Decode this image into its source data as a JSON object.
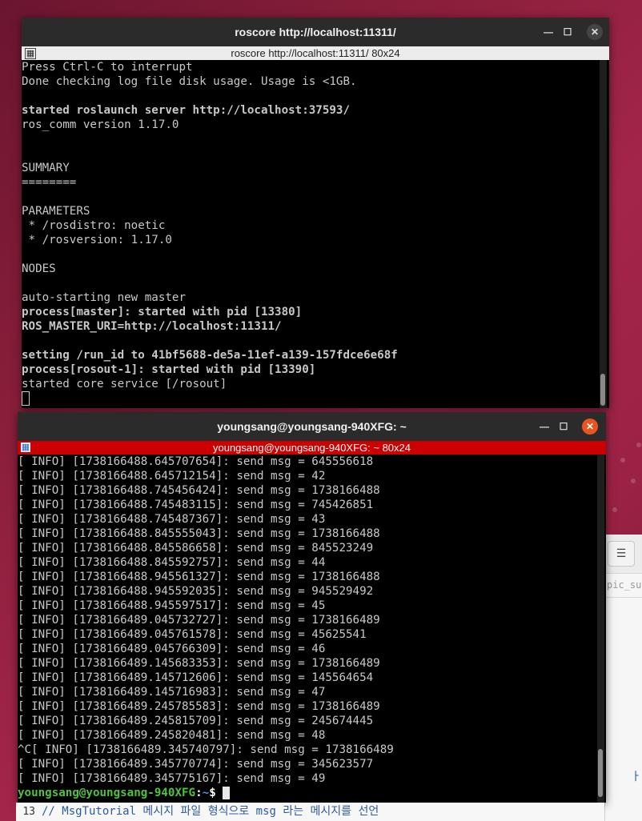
{
  "colors": {
    "terminal_bg": "#000000",
    "terminal_fg": "#c8c8c8",
    "prompt_green": "#4ec33b",
    "prompt_blue": "#5a8fe6",
    "close_orange": "#e95420",
    "tab_active_red": "#cc0000",
    "titlebar_dark": "#2b2b2b",
    "editor_comment_blue": "#2c5aa0"
  },
  "roscore_window": {
    "title": "roscore http://localhost:11311/",
    "tab_label": "roscore http://localhost:11311/ 80x24",
    "lines": [
      {
        "text": "Press Ctrl-C to interrupt",
        "bold": false
      },
      {
        "text": "Done checking log file disk usage. Usage is <1GB.",
        "bold": false
      },
      {
        "text": "",
        "bold": false
      },
      {
        "text": "started roslaunch server http://localhost:37593/",
        "bold": true
      },
      {
        "text": "ros_comm version 1.17.0",
        "bold": false
      },
      {
        "text": "",
        "bold": false
      },
      {
        "text": "",
        "bold": false
      },
      {
        "text": "SUMMARY",
        "bold": false
      },
      {
        "text": "========",
        "bold": false
      },
      {
        "text": "",
        "bold": false
      },
      {
        "text": "PARAMETERS",
        "bold": false
      },
      {
        "text": " * /rosdistro: noetic",
        "bold": false
      },
      {
        "text": " * /rosversion: 1.17.0",
        "bold": false
      },
      {
        "text": "",
        "bold": false
      },
      {
        "text": "NODES",
        "bold": false
      },
      {
        "text": "",
        "bold": false
      },
      {
        "text": "auto-starting new master",
        "bold": false
      },
      {
        "text": "process[master]: started with pid [13380]",
        "bold": true
      },
      {
        "text": "ROS_MASTER_URI=http://localhost:11311/",
        "bold": true
      },
      {
        "text": "",
        "bold": false
      },
      {
        "text": "setting /run_id to 41bf5688-de5a-11ef-a139-157fdce6e68f",
        "bold": true
      },
      {
        "text": "process[rosout-1]: started with pid [13390]",
        "bold": true
      },
      {
        "text": "started core service [/rosout]",
        "bold": false
      }
    ]
  },
  "publisher_window": {
    "title": "youngsang@youngsang-940XFG: ~",
    "tab_label": "youngsang@youngsang-940XFG: ~ 80x24",
    "lines": [
      "[ INFO] [1738166488.645707654]: send msg = 645556618",
      "[ INFO] [1738166488.645712154]: send msg = 42",
      "[ INFO] [1738166488.745456424]: send msg = 1738166488",
      "[ INFO] [1738166488.745483115]: send msg = 745426851",
      "[ INFO] [1738166488.745487367]: send msg = 43",
      "[ INFO] [1738166488.845555043]: send msg = 1738166488",
      "[ INFO] [1738166488.845586658]: send msg = 845523249",
      "[ INFO] [1738166488.845592757]: send msg = 44",
      "[ INFO] [1738166488.945561327]: send msg = 1738166488",
      "[ INFO] [1738166488.945592035]: send msg = 945529492",
      "[ INFO] [1738166488.945597517]: send msg = 45",
      "[ INFO] [1738166489.045732727]: send msg = 1738166489",
      "[ INFO] [1738166489.045761578]: send msg = 45625541",
      "[ INFO] [1738166489.045766309]: send msg = 46",
      "[ INFO] [1738166489.145683353]: send msg = 1738166489",
      "[ INFO] [1738166489.145712606]: send msg = 145564654",
      "[ INFO] [1738166489.145716983]: send msg = 47",
      "[ INFO] [1738166489.245785583]: send msg = 1738166489",
      "[ INFO] [1738166489.245815709]: send msg = 245674445",
      "[ INFO] [1738166489.245820481]: send msg = 48",
      "^C[ INFO] [1738166489.345740797]: send msg = 1738166489",
      "[ INFO] [1738166489.345770774]: send msg = 345623577",
      "[ INFO] [1738166489.345775167]: send msg = 49"
    ],
    "prompt_user": "youngsang@youngsang-940XFG",
    "prompt_sep": ":",
    "prompt_path": "~",
    "prompt_symbol": "$"
  },
  "background_editor": {
    "tab_fragment": "pic_sub",
    "line_number": "13",
    "line_text": "// MsgTutorial 메시지 파일 형식으로 msg 라는 메시지를 선언",
    "edge_glyph": "ㅏ"
  },
  "icons": {
    "tab_icon": "terminal-tab-icon",
    "minimize": "minimize-icon",
    "maximize": "maximize-icon",
    "close": "close-icon",
    "editor_menu": "hamburger-menu-icon"
  }
}
